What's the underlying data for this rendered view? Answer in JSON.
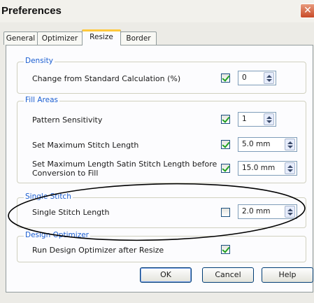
{
  "window": {
    "title": "Preferences",
    "close_glyph": "✕"
  },
  "tabs": [
    "General",
    "Optimizer",
    "Resize",
    "Border"
  ],
  "active_tab": "Resize",
  "groups": {
    "density": {
      "title": "Density",
      "rows": [
        {
          "label": "Change from Standard Calculation (%)",
          "checked": true,
          "value": "0"
        }
      ]
    },
    "fill_areas": {
      "title": "Fill Areas",
      "rows": [
        {
          "label": "Pattern Sensitivity",
          "checked": true,
          "value": "1"
        },
        {
          "label": "Set Maximum Stitch Length",
          "checked": true,
          "value": "5.0 mm"
        },
        {
          "label": "Set Maximum Length Satin Stitch Length before",
          "label2": "Conversion to Fill",
          "checked": true,
          "value": "15.0 mm"
        }
      ]
    },
    "single_stitch": {
      "title": "Single Stitch",
      "rows": [
        {
          "label": "Single Stitch Length",
          "checked": false,
          "value": "2.0 mm"
        }
      ]
    },
    "design_optimizer": {
      "title": "Design Optimizer",
      "rows": [
        {
          "label": "Run Design Optimizer after Resize",
          "checked": true
        }
      ]
    }
  },
  "buttons": {
    "ok": "OK",
    "cancel": "Cancel",
    "help": "Help"
  },
  "colors": {
    "group_title": "#1c5fd1",
    "active_tab_accent": "#ffc83c",
    "check": "#21a121",
    "annotation": "#000000"
  }
}
